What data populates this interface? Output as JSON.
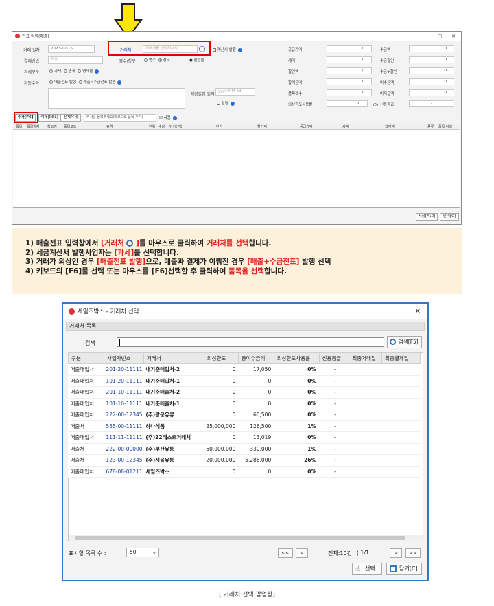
{
  "main_window": {
    "title": "전표 입력(매출)",
    "controls": [
      "─",
      "□",
      "✕"
    ],
    "labels": {
      "date": "거래 일자",
      "payment": "결제방법",
      "tax_type": "과세구분",
      "auto_collect": "자동수금",
      "partner": "거래처",
      "receipt": "영수/청구",
      "memo_date": "예정일정 일자"
    },
    "date_value": "2023-12-15",
    "payment_value": "외상",
    "partner_placeholder": "거래처를 선택하세요",
    "invoice_check": "계산서 발행",
    "discount_btn": "할인율",
    "receipt_opts": [
      "영수",
      "청구"
    ],
    "tax_opts": [
      "과세",
      "면세",
      "영세율"
    ],
    "collect_opts": [
      "매출전표 발행",
      "매출+수금전표 발행"
    ],
    "date_placeholder": "yyyy-MM-dd",
    "alarm": "알림",
    "right_fields": [
      {
        "label": "공급가액",
        "value": "0"
      },
      {
        "label": "세액",
        "value": "0"
      },
      {
        "label": "할인액",
        "value": "0"
      },
      {
        "label": "합계금액",
        "value": "0"
      },
      {
        "label": "품목갯수",
        "value": "0"
      },
      {
        "label": "외상한도사용률",
        "value": "0"
      }
    ],
    "pct": "(%)",
    "right_fields2": [
      {
        "label": "수금액",
        "value": "0"
      },
      {
        "label": "수금할인",
        "value": "0"
      },
      {
        "label": "수금+할인",
        "value": "0"
      },
      {
        "label": "미수금액",
        "value": "0"
      },
      {
        "label": "미지급액",
        "value": "0"
      },
      {
        "label": "신용등급",
        "value": "-"
      }
    ],
    "toolbar": {
      "add": "추가[F6]",
      "delete": "삭제[DEL]",
      "delete_all": "전체삭제",
      "barcode_placeholder": "커서를 올려주세요(바코드로 품목 추가)",
      "use": "사용"
    },
    "grid_headers": [
      "품목",
      "품목일자",
      "창고명",
      "품목코드",
      "규격",
      "단위",
      "수량",
      "단가선택",
      "단가",
      "할인액",
      "공급가액",
      "세액",
      "합계액",
      "종류",
      "품목 이력"
    ],
    "footer": {
      "save": "저장[F10]",
      "close": "닫기[C]"
    }
  },
  "instructions": {
    "line1_a": "1) 매출전표 입력창에서 ",
    "line1_b": "[거래처",
    "line1_c": "]",
    "line1_d": "를 마우스로 클릭하여 ",
    "line1_e": "거래처를 선택",
    "line1_f": "합니다.",
    "line2_a": "2) 세금계산서 발행사업자는 ",
    "line2_b": "[과세]",
    "line2_c": "를 선택합니다.",
    "line3_a": "3) 거래가 외상인 경우 ",
    "line3_b": "[매출전표 발행]",
    "line3_c": "으로, 매출과 결제가 이뤄진 경우 ",
    "line3_d": "[매출+수금전표]",
    "line3_e": " 발행 선택",
    "line4_a": "4) 키보드의 [F6]를 선택 또는 마우스를 [F6]선택한 후 클릭하여 ",
    "line4_b": "품목을 선택",
    "line4_c": "합니다."
  },
  "dialog": {
    "title": "세일즈박스 - 거래처 선택",
    "section": "거래처 목록",
    "search_label": "검색",
    "search_btn": "검색[F5]",
    "columns": [
      "구분",
      "사업자번호",
      "거래처",
      "외상한도",
      "총미수금액",
      "외상한도사용률",
      "신용등급",
      "최종거래일",
      "최종결제일"
    ],
    "rows": [
      [
        "매출매입처",
        "201-20-11111",
        "내기준매입처-2",
        "0",
        "17,050",
        "0%",
        "-"
      ],
      [
        "매출매입처",
        "101-20-11111",
        "내기준매입처-1",
        "0",
        "0",
        "0%",
        "-"
      ],
      [
        "매출매입처",
        "201-10-11111",
        "내기준매출처-2",
        "0",
        "0",
        "0%",
        "-"
      ],
      [
        "매출매입처",
        "101-10-11111",
        "내기준매출처-1",
        "0",
        "0",
        "0%",
        "-"
      ],
      [
        "매출매입처",
        "222-00-12345",
        "(주)광운유류",
        "0",
        "60,500",
        "0%",
        "-"
      ],
      [
        "매출처",
        "555-00-11111",
        "하나식품",
        "25,000,000",
        "126,500",
        "1%",
        "-"
      ],
      [
        "매출매입처",
        "111-11-11111",
        "(주)22테스트거래처",
        "0",
        "13,019",
        "0%",
        "-"
      ],
      [
        "매출처",
        "222-00-00000",
        "(주)부산유통",
        "50,000,000",
        "330,000",
        "1%",
        "-"
      ],
      [
        "매출처",
        "123-00-12345",
        "(주)서울유통",
        "20,000,000",
        "5,286,000",
        "26%",
        "-"
      ],
      [
        "매출매입처",
        "678-08-01211",
        "세일즈박스",
        "0",
        "0",
        "0%",
        "-"
      ]
    ],
    "page_size_label": "표시할 목록 수 :",
    "page_size": "50",
    "nav_first": "<<",
    "nav_prev": "<",
    "nav_next": ">",
    "nav_last": ">>",
    "total": "전체:10건",
    "page": "1/1",
    "select_btn": "선택",
    "close_btn": "닫기[C]"
  },
  "caption": "[ 거래처 선택 팝업창]"
}
